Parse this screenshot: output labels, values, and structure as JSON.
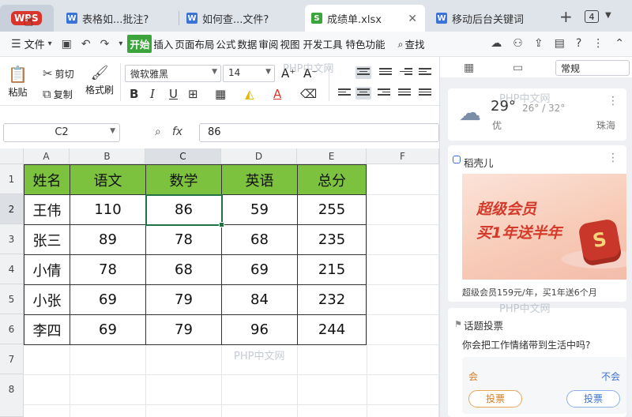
{
  "tabs": {
    "home_label": "WPS",
    "items": [
      {
        "label": "表格如...批注?",
        "type": "W"
      },
      {
        "label": "如何查...文件?",
        "type": "W"
      },
      {
        "label": "成绩单.xlsx",
        "type": "S"
      },
      {
        "label": "移动后台关键词",
        "type": "W"
      }
    ],
    "close_glyph": "✕",
    "new_tab": "+",
    "window_count": "4"
  },
  "menu": {
    "file_label": "文件",
    "items": [
      "开始",
      "插入",
      "页面布局",
      "公式",
      "数据",
      "审阅",
      "视图",
      "开发工具",
      "特色功能"
    ],
    "search_label": "查找"
  },
  "ribbon": {
    "paste": "粘贴",
    "cut": "剪切",
    "copy": "复制",
    "format_painter": "格式刷",
    "font_name": "微软雅黑",
    "font_size": "14",
    "bold": "B",
    "italic": "I",
    "underline": "U",
    "font_grow": "A⁺",
    "font_shrink": "A⁻",
    "font_color": "A"
  },
  "formula_bar": {
    "name_box": "C2",
    "fx": "fx",
    "value": "86"
  },
  "sheet": {
    "columns": [
      "A",
      "B",
      "C",
      "D",
      "E",
      "F"
    ],
    "rows": [
      "1",
      "2",
      "3",
      "4",
      "5",
      "6",
      "7",
      "8"
    ],
    "selected_col": "C",
    "selected_row": "2",
    "header_fill": "#7dc23e",
    "headers": [
      "姓名",
      "语文",
      "数学",
      "英语",
      "总分"
    ],
    "data": [
      [
        "王伟",
        "110",
        "86",
        "59",
        "255"
      ],
      [
        "张三",
        "89",
        "78",
        "68",
        "235"
      ],
      [
        "小倩",
        "78",
        "68",
        "69",
        "215"
      ],
      [
        "小张",
        "69",
        "79",
        "84",
        "232"
      ],
      [
        "李四",
        "69",
        "79",
        "96",
        "244"
      ]
    ]
  },
  "side_panel": {
    "dropdown": "常规",
    "weather": {
      "temp": "29°",
      "range": "26° / 32°",
      "condition": "优",
      "city": "珠海"
    },
    "ad": {
      "title": "稻壳儿",
      "line1": "超级会员",
      "line2": "买1年送半年",
      "caption": "超级会员159元/年，买1年送6个月"
    },
    "vote": {
      "title": "话题投票",
      "question": "你会把工作情绪带到生活中吗?",
      "option_yes": "会",
      "option_no": "不会",
      "vote_label": "投票"
    }
  },
  "watermark": "PHP中文网"
}
